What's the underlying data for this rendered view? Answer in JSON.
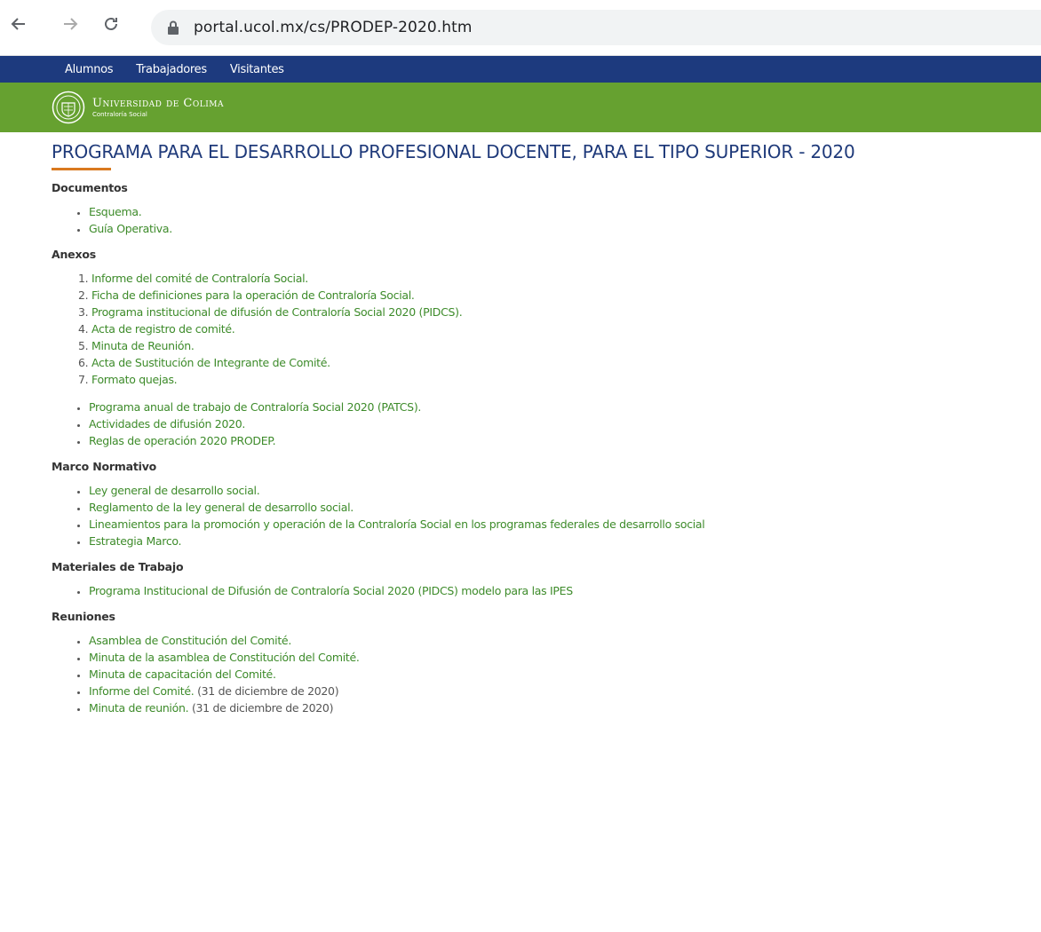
{
  "browser": {
    "url": "portal.ucol.mx/cs/PRODEP-2020.htm"
  },
  "topnav": {
    "items": [
      "Alumnos",
      "Trabajadores",
      "Visitantes"
    ]
  },
  "header": {
    "title": "Universidad de Colima",
    "subtitle": "Contraloría Social"
  },
  "page": {
    "title": "PROGRAMA PARA EL DESARROLLO PROFESIONAL DOCENTE, PARA EL TIPO SUPERIOR - 2020"
  },
  "documentos": {
    "heading": "Documentos",
    "items": [
      "Esquema.",
      "Guía Operativa."
    ]
  },
  "anexos": {
    "heading": "Anexos",
    "numbered": [
      "Informe del comité de Contraloría Social.",
      "Ficha de definiciones para la operación de Contraloría Social.",
      "Programa institucional de difusión de Contraloría Social 2020 (PIDCS).",
      "Acta de registro de comité.",
      "Minuta de Reunión.",
      "Acta de Sustitución de Integrante de Comité.",
      "Formato quejas."
    ],
    "bulleted": [
      "Programa anual de trabajo de Contraloría Social 2020 (PATCS).",
      "Actividades de difusión 2020.",
      "Reglas de operación 2020 PRODEP."
    ]
  },
  "marco": {
    "heading": "Marco Normativo",
    "items": [
      "Ley general de desarrollo social.",
      "Reglamento de la ley general de desarrollo social.",
      "Lineamientos para la promoción y operación de la Contraloría Social en los programas federales de desarrollo social",
      "Estrategia Marco."
    ]
  },
  "materiales": {
    "heading": "Materiales de Trabajo",
    "items": [
      "Programa Institucional de Difusión de Contraloría Social 2020 (PIDCS) modelo para las IPES"
    ]
  },
  "reuniones": {
    "heading": "Reuniones",
    "items": [
      {
        "link": "Asamblea de Constitución del Comité.",
        "note": ""
      },
      {
        "link": "Minuta de la asamblea de Constitución del Comité.",
        "note": ""
      },
      {
        "link": "Minuta de capacitación del Comité.",
        "note": ""
      },
      {
        "link": "Informe del Comité.",
        "note": " (31 de diciembre de 2020)"
      },
      {
        "link": "Minuta de reunión.",
        "note": " (31 de diciembre de 2020)"
      }
    ]
  },
  "colors": {
    "topnav": "#1d3a7e",
    "header": "#66a130",
    "title": "#1f3a7a",
    "accent": "#d9791f",
    "link": "#3d8b2a"
  }
}
